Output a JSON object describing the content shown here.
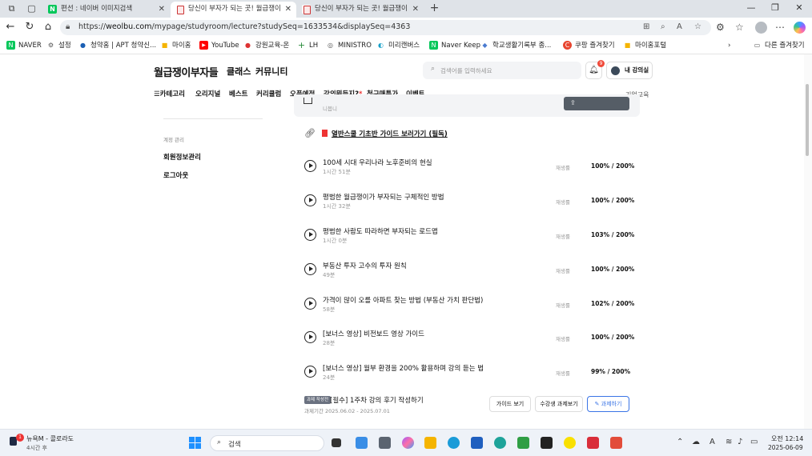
{
  "browser": {
    "tabs": [
      {
        "title": "편선 : 네이버 이미지검색",
        "favicon": "naver"
      },
      {
        "title": "당신이 부자가 되는 곳! 월급쟁이",
        "favicon": "pdf"
      },
      {
        "title": "당신이 부자가 되는 곳! 월급쟁이",
        "favicon": "pdf"
      }
    ],
    "new_tab": "+",
    "url_prefix": "https://",
    "url_host": "weolbu.com",
    "url_path": "/mypage/studyroom/lecture?studySeq=1633534&displaySeq=4363",
    "bookmarks": [
      {
        "label": "NAVER",
        "color": "#03c75a",
        "glyph": "N"
      },
      {
        "label": "설정",
        "color": "#666666",
        "glyph": "⚙"
      },
      {
        "label": "청약홈 | APT 청약신...",
        "color": "#1a5fb4",
        "glyph": "●"
      },
      {
        "label": "마이홈",
        "color": "#f5b400",
        "glyph": "■"
      },
      {
        "label": "YouTube",
        "color": "#ff0000",
        "glyph": "▶"
      },
      {
        "label": "강원교육-온",
        "color": "#d33",
        "glyph": "●"
      },
      {
        "label": "LH",
        "color": "#2a8c3c",
        "glyph": "+"
      },
      {
        "label": "MINISTRO",
        "color": "#555555",
        "glyph": "◎"
      },
      {
        "label": "미리캔버스",
        "color": "#18a0c8",
        "glyph": "◐"
      },
      {
        "label": "Naver Keep",
        "color": "#03c75a",
        "glyph": "N"
      },
      {
        "label": "학교생활기록부 종...",
        "color": "#4a7bd0",
        "glyph": "◆"
      },
      {
        "label": "쿠팡 즐겨찾기",
        "color": "#e8452f",
        "glyph": "C"
      },
      {
        "label": "마이홈포털",
        "color": "#f5b400",
        "glyph": "■"
      }
    ],
    "other_bookmarks": "다른 즐겨찾기"
  },
  "site": {
    "logo": "월급쟁이부자들",
    "nav": [
      "클래스",
      "커뮤니티"
    ],
    "search_placeholder": "검색어를 입력하세요",
    "notification_count": "9",
    "my_room": "내 강의실",
    "subnav": [
      "☰카테고리",
      "오리지널",
      "베스트",
      "커리큘럼",
      "오픈예정",
      "강의뭐듣지?",
      "첫구매특가",
      "이벤트"
    ],
    "subnav_star": "*",
    "corp": "기업교육"
  },
  "sidebar": {
    "section": "계정 관리",
    "links": [
      "회원정보관리",
      "로그아웃"
    ]
  },
  "main": {
    "topcard_text": "니봅니",
    "guide": "열반스쿨 기초반 가이드 보러가기 (필독)",
    "rate_label": "재생률",
    "lectures": [
      {
        "title": "100세 시대 우리나라 노후준비의 현실",
        "duration": "1시간 51분",
        "rate": "100% / 200%"
      },
      {
        "title": "평범한 월급쟁이가 부자되는 구체적인 방법",
        "duration": "1시간 32분",
        "rate": "100% / 200%"
      },
      {
        "title": "평범한 사람도 따라하면 부자되는 로드맵",
        "duration": "1시간 0분",
        "rate": "103% / 200%"
      },
      {
        "title": "부동산 투자 고수의 투자 원칙",
        "duration": "49분",
        "rate": "100% / 200%"
      },
      {
        "title": "가격이 많이 오를 아파트 찾는 방법 (부동산 가치 판단법)",
        "duration": "58분",
        "rate": "102% / 200%"
      },
      {
        "title": "[보너스 영상] 비전보드 영상 가이드",
        "duration": "28분",
        "rate": "100% / 200%"
      },
      {
        "title": "[보너스 영상] 월부 환경을 200% 활용하며 강의 듣는 법",
        "duration": "24분",
        "rate": "99% / 200%"
      }
    ],
    "homework": {
      "tag": "과제 작성전",
      "title": "[필수] 1주차 강의 후기 작성하기",
      "period": "과제기간 2025.06.02 - 2025.07.01",
      "buttons": [
        "가이드 보기",
        "수강생 과제보기",
        "✎ 과제하기"
      ]
    }
  },
  "taskbar": {
    "weather_badge": "1",
    "news_title": "뉴욕M - 콜로라도",
    "news_sub": "4시간 후",
    "search": "검색",
    "time": "오전 12:14",
    "date": "2025-06-09"
  }
}
